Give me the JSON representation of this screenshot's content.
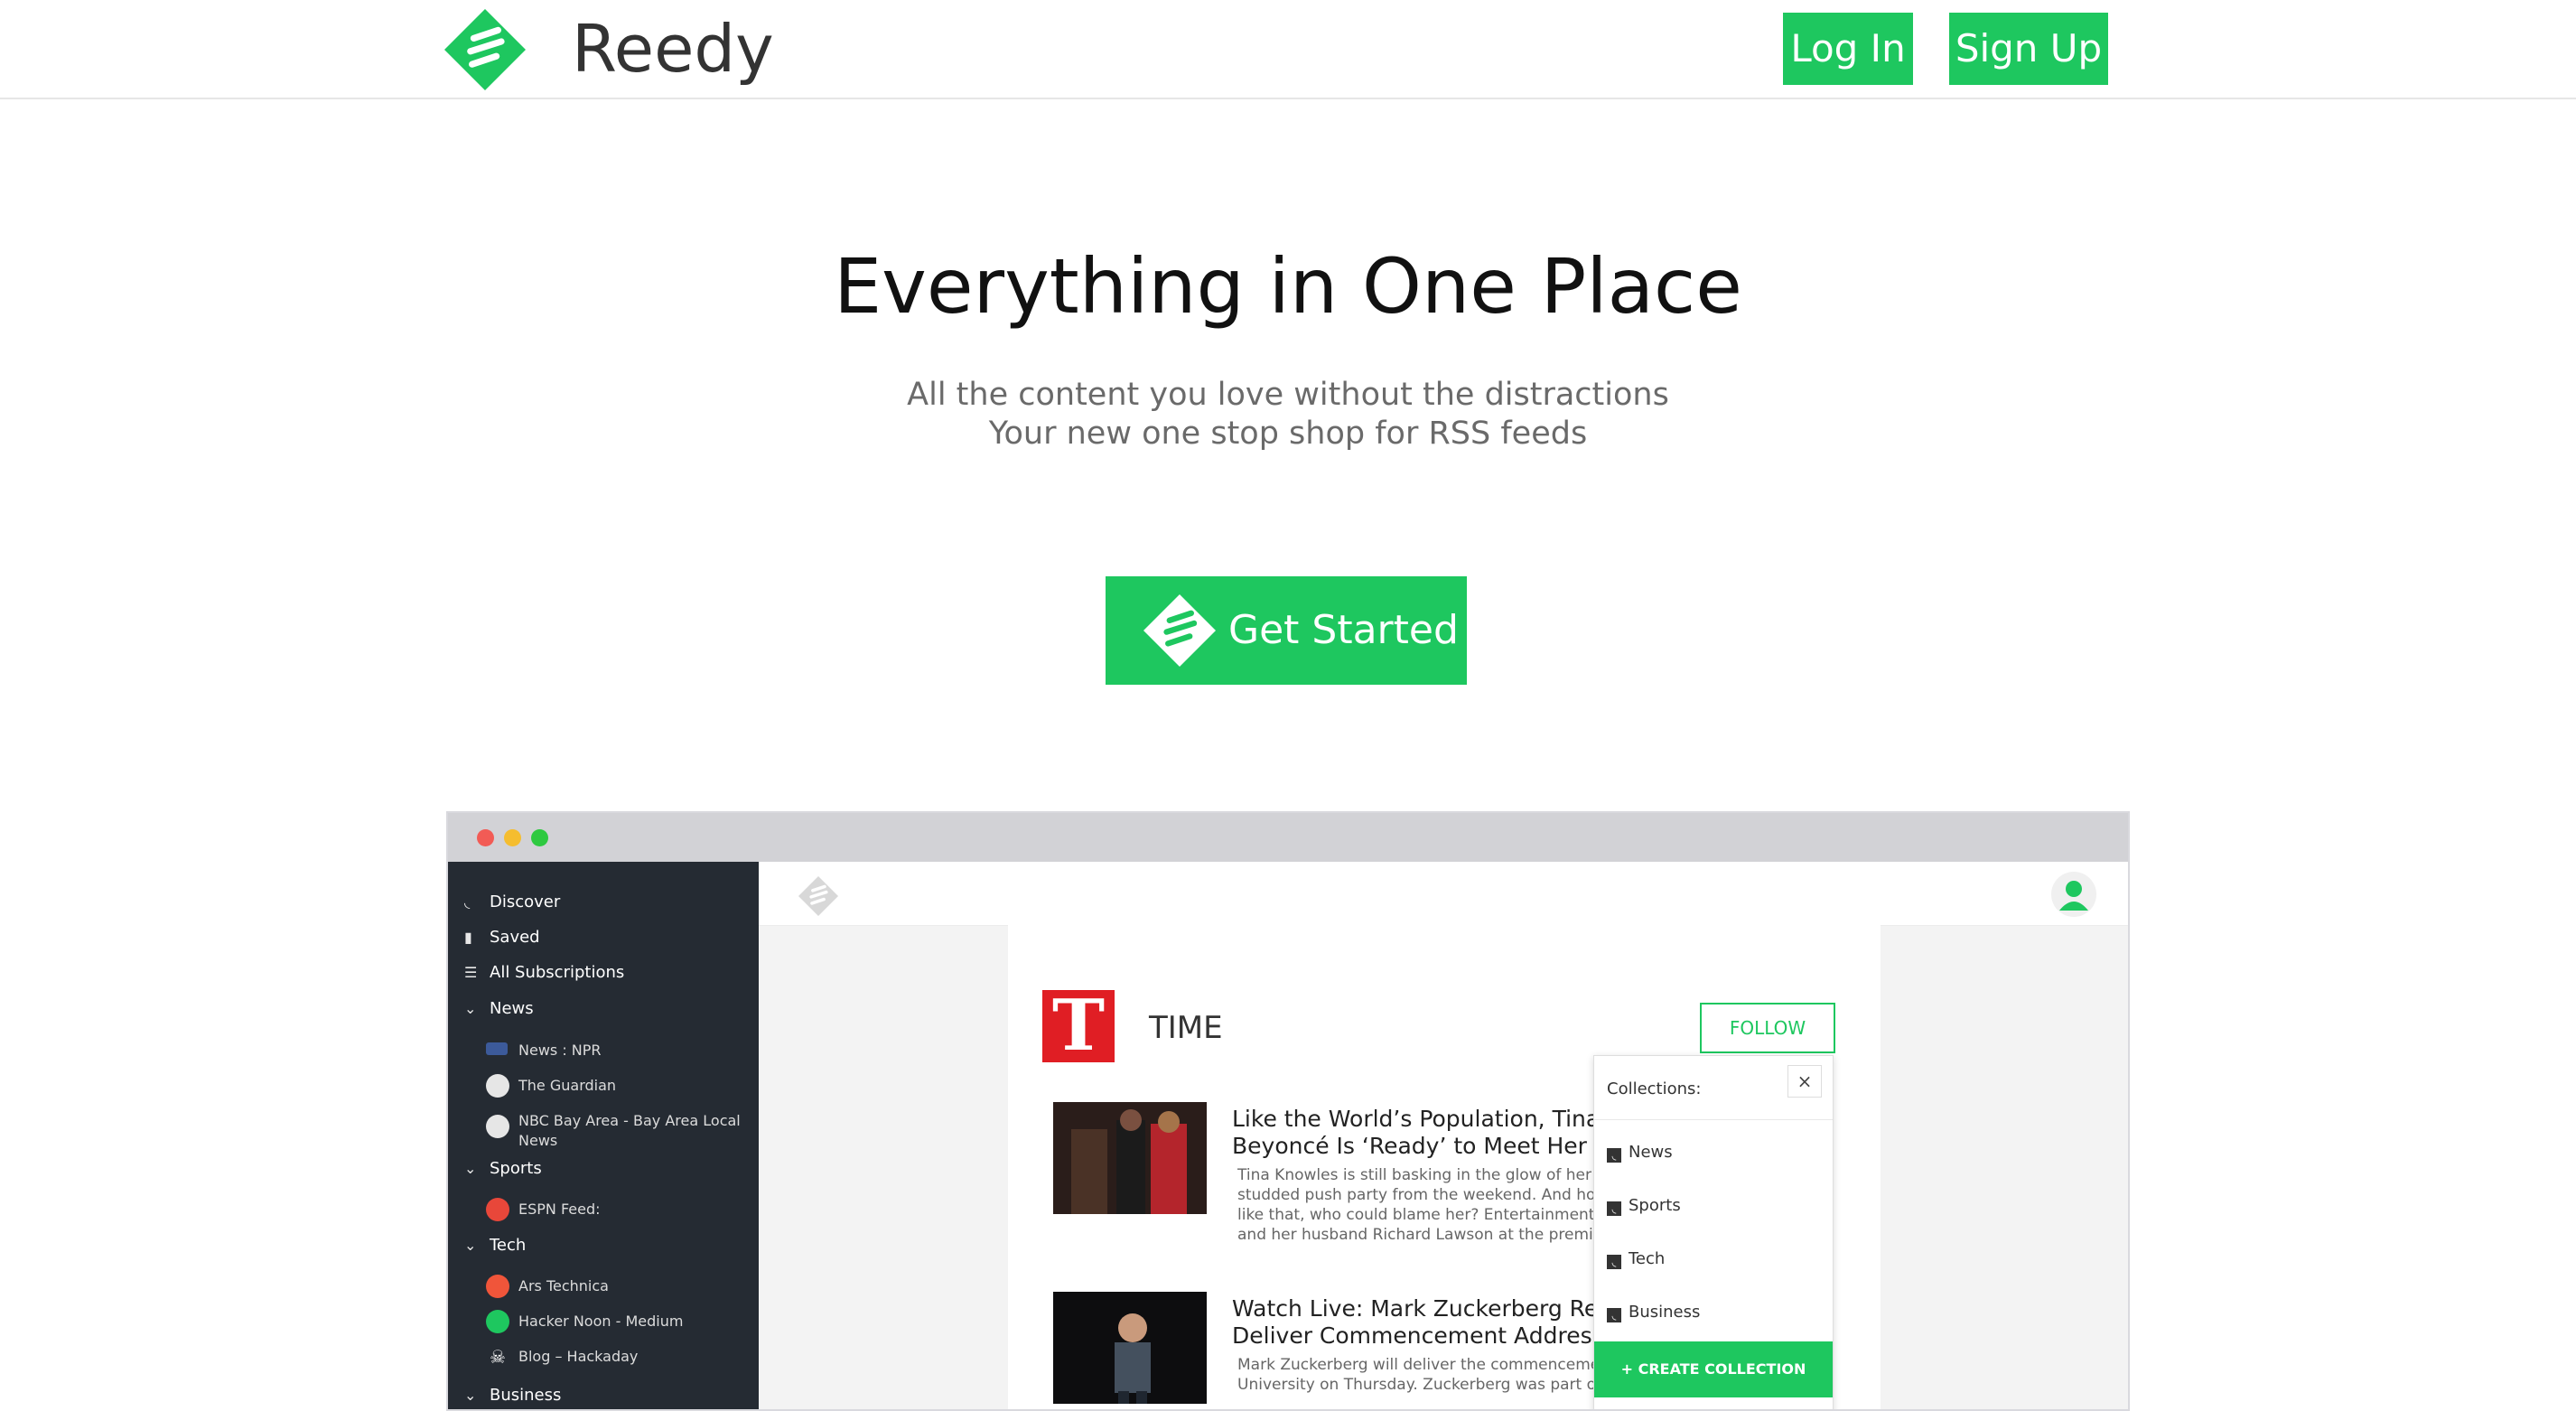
{
  "header": {
    "brand": "Reedy",
    "login_label": "Log In",
    "signup_label": "Sign Up"
  },
  "hero": {
    "title": "Everything in One Place",
    "subtitle_line1": "All the content you love without the distractions",
    "subtitle_line2": "Your new one stop shop for RSS feeds",
    "cta_label": "Get Started"
  },
  "colors": {
    "accent": "#1ec75f",
    "sidebar_bg": "#252b33",
    "time_red": "#e01e24"
  },
  "mock_app": {
    "sidebar": {
      "top_items": [
        {
          "label": "Discover",
          "icon": "rss-icon"
        },
        {
          "label": "Saved",
          "icon": "bookmark-icon"
        },
        {
          "label": "All Subscriptions",
          "icon": "list-icon"
        }
      ],
      "groups": [
        {
          "label": "News",
          "feeds": [
            "News : NPR",
            "The Guardian",
            "NBC Bay Area - Bay Area Local News"
          ]
        },
        {
          "label": "Sports",
          "feeds": [
            "ESPN Feed:"
          ]
        },
        {
          "label": "Tech",
          "feeds": [
            "Ars Technica",
            "Hacker Noon - Medium",
            "Blog – Hackaday"
          ]
        },
        {
          "label": "Business",
          "feeds": []
        }
      ]
    },
    "source": {
      "logo_letter": "T",
      "name": "TIME",
      "follow_label": "FOLLOW"
    },
    "articles": [
      {
        "title_line1": "Like the World’s Population, Tina Kno",
        "title_line2": "Beyoncé Is ‘Ready’ to Meet Her Babie",
        "snippet": [
          "Tina Knowles is still basking in the glow of her d",
          "studded push party from the weekend. And hon",
          "like that, who could blame her? Entertainment",
          "and her husband Richard Lawson at the premi"
        ]
      },
      {
        "title_line1": "Watch Live: Mark Zuckerberg Return",
        "title_line2": "Deliver Commencement Address",
        "snippet": [
          "Mark Zuckerberg will deliver the commenceme",
          "University on Thursday. Zuckerberg was part of"
        ]
      }
    ],
    "collections_popup": {
      "heading": "Collections:",
      "close_label": "×",
      "items": [
        "News",
        "Sports",
        "Tech",
        "Business"
      ],
      "create_label": "+ CREATE COLLECTION"
    }
  }
}
